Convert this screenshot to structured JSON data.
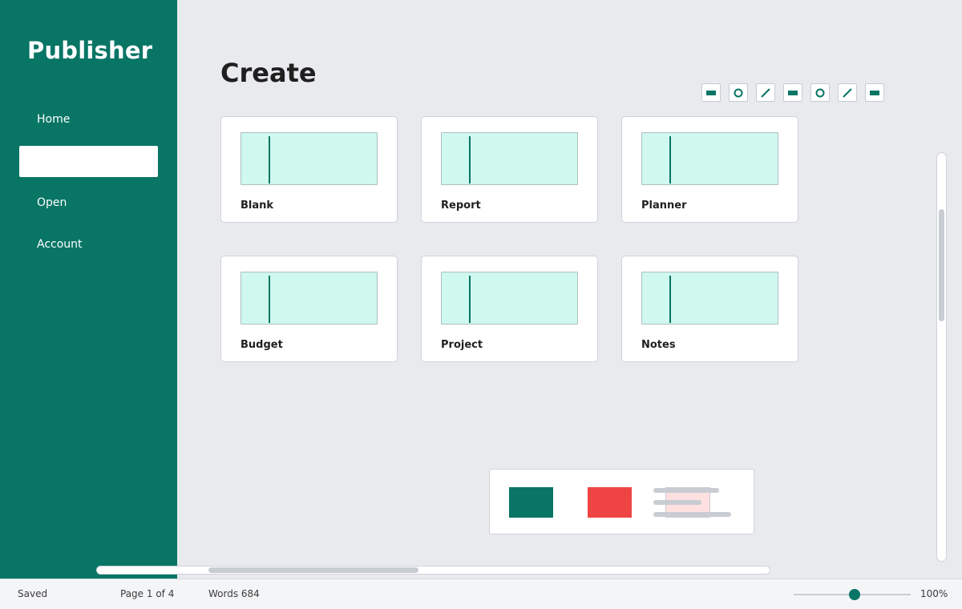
{
  "app": {
    "title": "Publisher"
  },
  "sidebar": {
    "items": [
      {
        "label": "Home"
      },
      {
        "label": ""
      },
      {
        "label": "Open"
      },
      {
        "label": "Account"
      }
    ]
  },
  "main": {
    "heading": "Create",
    "templates": [
      {
        "label": "Blank"
      },
      {
        "label": "Report"
      },
      {
        "label": "Planner"
      },
      {
        "label": "Budget"
      },
      {
        "label": "Project"
      },
      {
        "label": "Notes"
      }
    ]
  },
  "toolbar": {
    "tools": [
      "rectangle-icon",
      "circle-icon",
      "line-icon",
      "rectangle-icon",
      "circle-icon",
      "line-icon",
      "rectangle-icon"
    ]
  },
  "swatches": {
    "colors": {
      "primary": "#087565",
      "accent": "#ef4444",
      "text_highlight": "#ffe0e0"
    }
  },
  "statusbar": {
    "save_state": "Saved",
    "page_info": "Page 1 of 4",
    "word_count": "Words 684",
    "zoom": "100%"
  },
  "colors": {
    "brand": "#087565",
    "background": "#e9eaee",
    "thumbnail": "#cff8ef"
  }
}
